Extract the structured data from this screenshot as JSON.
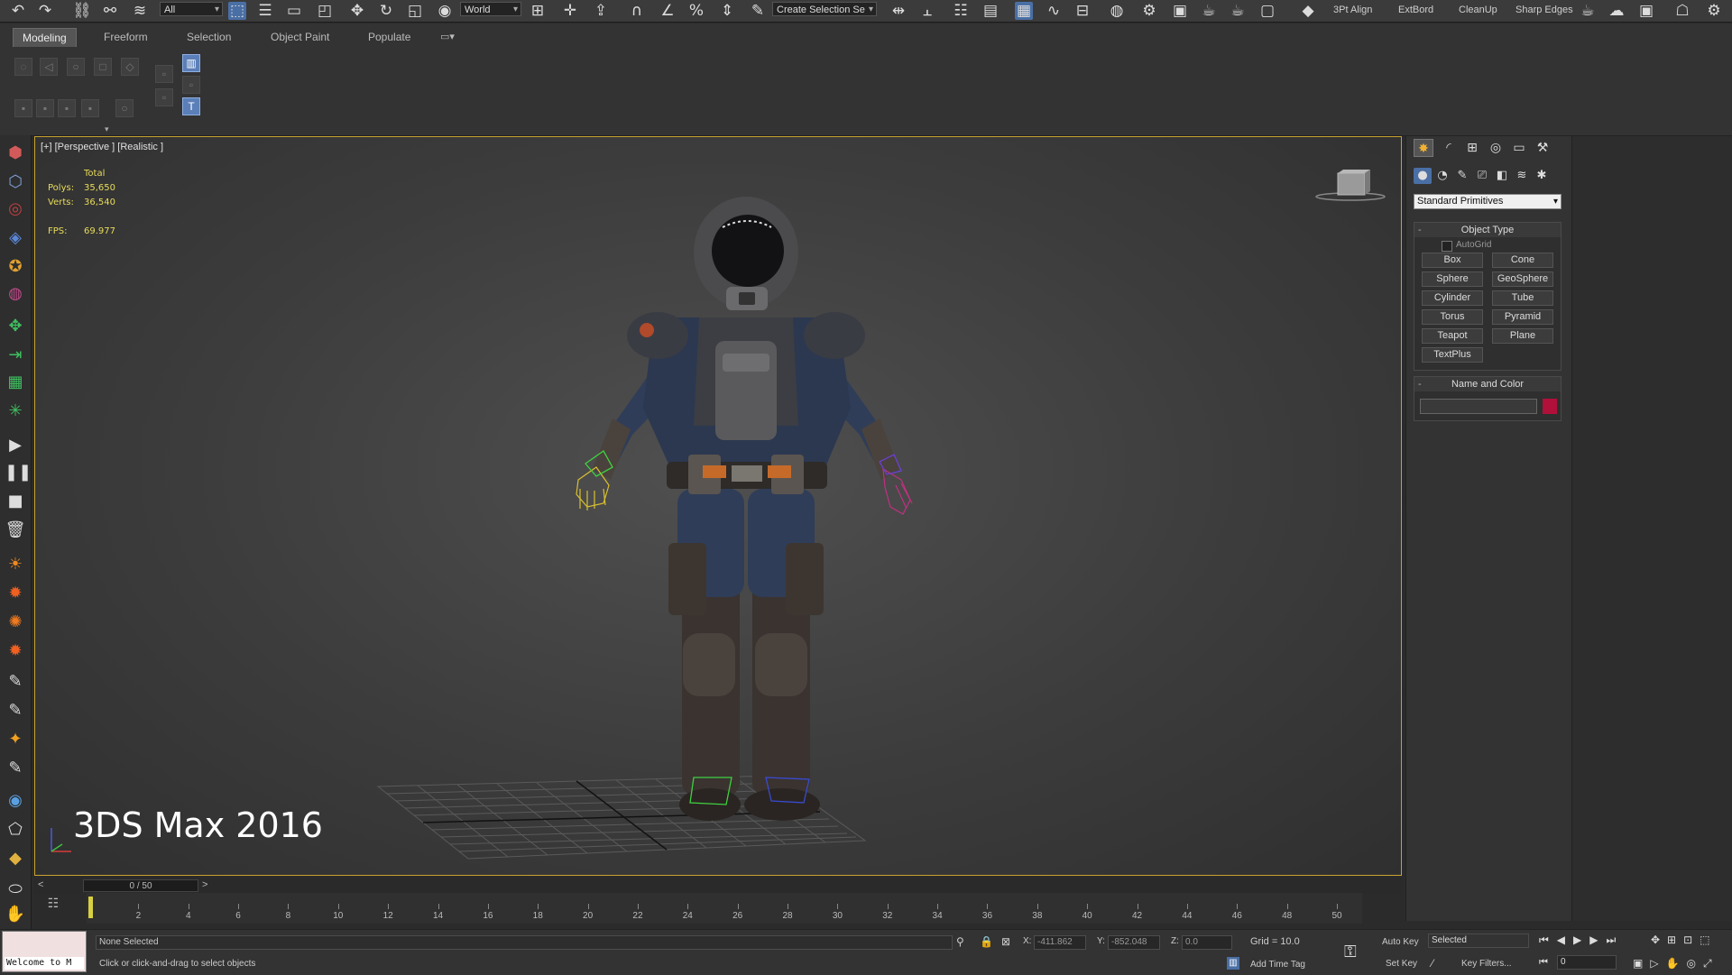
{
  "toolbar": {
    "selection_filter": "All",
    "reference_coord": "World",
    "named_selection_placeholder": "Create Selection Se",
    "extra_tools": [
      "3Pt Align",
      "ExtBord",
      "CleanUp",
      "Sharp Edges"
    ]
  },
  "ribbon": {
    "tabs": [
      "Modeling",
      "Freeform",
      "Selection",
      "Object Paint",
      "Populate"
    ]
  },
  "viewport": {
    "label": "[+] [Perspective ] [Realistic ]",
    "stats": {
      "total_label": "Total",
      "polys_label": "Polys:",
      "polys_value": "35,650",
      "verts_label": "Verts:",
      "verts_value": "36,540",
      "fps_label": "FPS:",
      "fps_value": "69.977"
    },
    "watermark": "3DS Max 2016"
  },
  "command_panel": {
    "category": "Standard Primitives",
    "object_type_title": "Object Type",
    "autogrid_label": "AutoGrid",
    "primitives": [
      "Box",
      "Cone",
      "Sphere",
      "GeoSphere",
      "Cylinder",
      "Tube",
      "Torus",
      "Pyramid",
      "Teapot",
      "Plane",
      "TextPlus"
    ],
    "name_color_title": "Name and Color",
    "object_color": "#b0103a"
  },
  "timeline": {
    "frame_display": "0 / 50",
    "prev": "<",
    "next": ">",
    "ticks": [
      "2",
      "4",
      "6",
      "8",
      "10",
      "12",
      "14",
      "16",
      "18",
      "20",
      "22",
      "24",
      "26",
      "28",
      "30",
      "32",
      "34",
      "36",
      "38",
      "40",
      "42",
      "44",
      "46",
      "48",
      "50"
    ]
  },
  "status": {
    "maxscript_text": "Welcome to M",
    "selection_status": "None Selected",
    "prompt": "Click or click-and-drag to select objects",
    "x_label": "X:",
    "x_value": "-411.862",
    "y_label": "Y:",
    "y_value": "-852.048",
    "z_label": "Z:",
    "z_value": "0.0",
    "grid": "Grid = 10.0",
    "add_time_tag": "Add Time Tag",
    "auto_key": "Auto Key",
    "set_key": "Set Key",
    "key_mode": "Selected",
    "key_filters": "Key Filters...",
    "current_frame": "0"
  },
  "colors": {
    "viewport_border": "#c8a230",
    "stats_text": "#e8dc5a",
    "accent_blue": "#4a6fa5"
  }
}
